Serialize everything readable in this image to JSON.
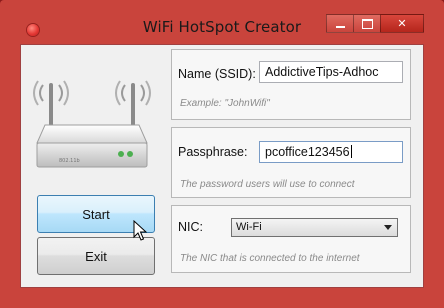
{
  "window": {
    "title": "WiFi HotSpot Creator",
    "colors": {
      "frame": "#c9443c",
      "client": "#f0f0f0",
      "start_button": "#bee6fd"
    }
  },
  "title_controls": {
    "minimize_icon": "minimize-icon",
    "maximize_icon": "maximize-icon",
    "close_icon": "close-icon",
    "close_glyph": "✕"
  },
  "graphic": {
    "icon": "wifi-router-icon",
    "model_text": "802.11b"
  },
  "ssid": {
    "label": "Name (SSID):",
    "value": "AddictiveTips-Adhoc",
    "hint": "Example: \"JohnWifi\""
  },
  "passphrase": {
    "label": "Passphrase:",
    "value": "pcoffice123456",
    "hint": "The password users will use to connect"
  },
  "nic": {
    "label": "NIC:",
    "selected": "Wi-Fi",
    "hint": "The NIC that is connected to the internet"
  },
  "buttons": {
    "start": "Start",
    "exit": "Exit"
  }
}
